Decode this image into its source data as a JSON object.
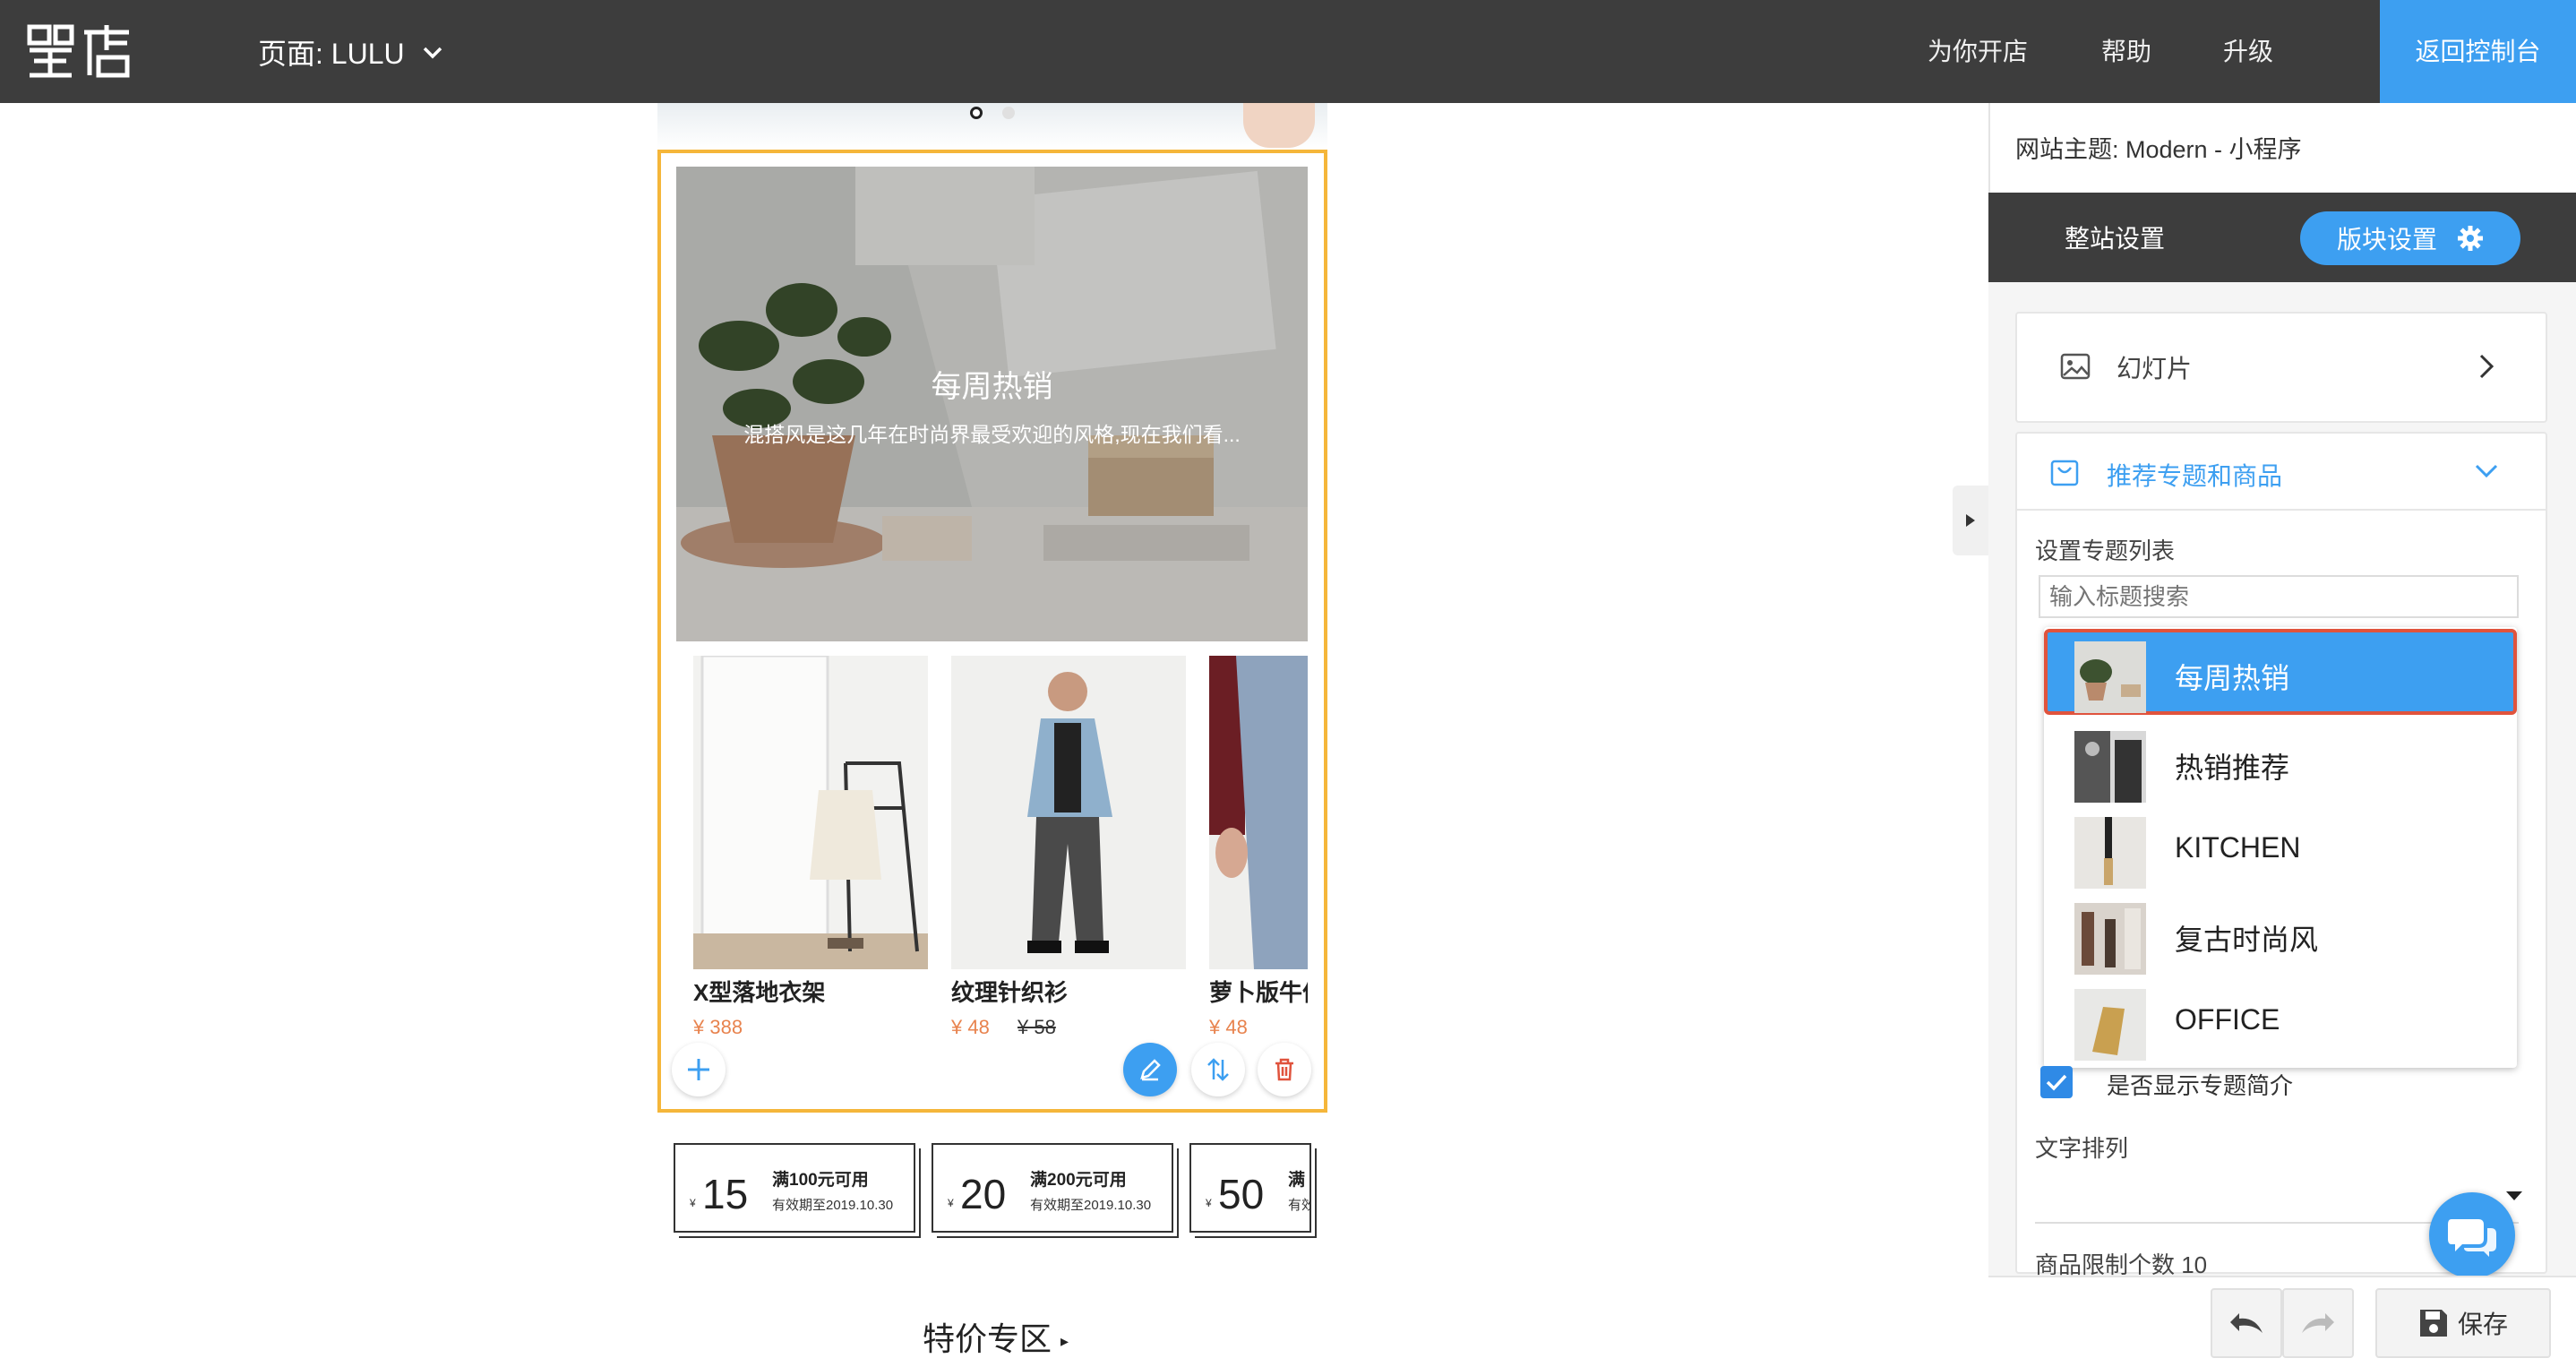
{
  "header": {
    "logo_text": "喔店",
    "page_label": "页面: LULU",
    "nav": [
      "为你开店",
      "帮助",
      "升级"
    ],
    "return_label": "返回控制台"
  },
  "preview": {
    "hero_title": "每周热销",
    "hero_subtitle": "混搭风是这几年在时尚界最受欢迎的风格,现在我们看...",
    "products": [
      {
        "name": "X型落地衣架",
        "price": "¥ 388",
        "old_price": ""
      },
      {
        "name": "纹理针织衫",
        "price": "¥ 48",
        "old_price": "¥ 58"
      },
      {
        "name": "萝卜版牛仔",
        "price": "¥ 48",
        "old_price": ""
      }
    ],
    "coupons": [
      {
        "currency": "¥",
        "amount": "15",
        "condition": "满100元可用",
        "expiry": "有效期至2019.10.30"
      },
      {
        "currency": "¥",
        "amount": "20",
        "condition": "满200元可用",
        "expiry": "有效期至2019.10.30"
      },
      {
        "currency": "¥",
        "amount": "50",
        "condition": "满",
        "expiry": "有效"
      }
    ],
    "special_title": "特价专区",
    "special_arrow": "▸"
  },
  "panel": {
    "theme_label": "网站主题:  Modern - 小程序",
    "tab_site": "整站设置",
    "tab_block": "版块设置",
    "slides_label": "幻灯片",
    "recommend_label": "推荐专题和商品",
    "list_label": "设置专题列表",
    "search_placeholder": "输入标题搜索",
    "dropdown_items": [
      "每周热销",
      "热销推荐",
      "KITCHEN",
      "复古时尚风",
      "OFFICE"
    ],
    "show_intro_label": "是否显示专题简介",
    "show_intro_checked": true,
    "text_align_label": "文字排列",
    "limit_label": "商品限制个数 10",
    "save_label": "保存"
  },
  "colors": {
    "accent": "#3d9ff1",
    "topbar": "#3d3d3d",
    "highlight_border": "#f5b63a",
    "selected_border": "#e0533d",
    "price": "#e8834e"
  }
}
